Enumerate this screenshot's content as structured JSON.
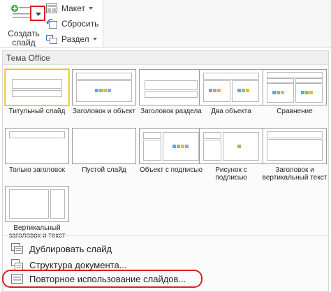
{
  "ribbon": {
    "new_slide_line1": "Создать",
    "new_slide_line2": "слайд",
    "layout_label": "Макет",
    "reset_label": "Сбросить",
    "section_label": "Раздел"
  },
  "gallery": {
    "header": "Тема Office",
    "layouts": [
      {
        "label": "Титульный слайд"
      },
      {
        "label": "Заголовок и объект"
      },
      {
        "label": "Заголовок раздела"
      },
      {
        "label": "Два объекта"
      },
      {
        "label": "Сравнение"
      },
      {
        "label": "Только заголовок"
      },
      {
        "label": "Пустой слайд"
      },
      {
        "label": "Объект с подписью"
      },
      {
        "label_line1": "Рисунок с",
        "label_line2": "подписью"
      },
      {
        "label_line1": "Заголовок и",
        "label_line2": "вертикальный текст"
      },
      {
        "label_line1": "Вертикальный",
        "label_line2": "заголовок и текст"
      }
    ]
  },
  "menu": {
    "duplicate": "Дублировать слайд",
    "outline": "Структура документа...",
    "reuse": "Повторное использование слайдов..."
  },
  "colors": {
    "highlight": "#d92020",
    "selected_border": "#f2c200"
  }
}
